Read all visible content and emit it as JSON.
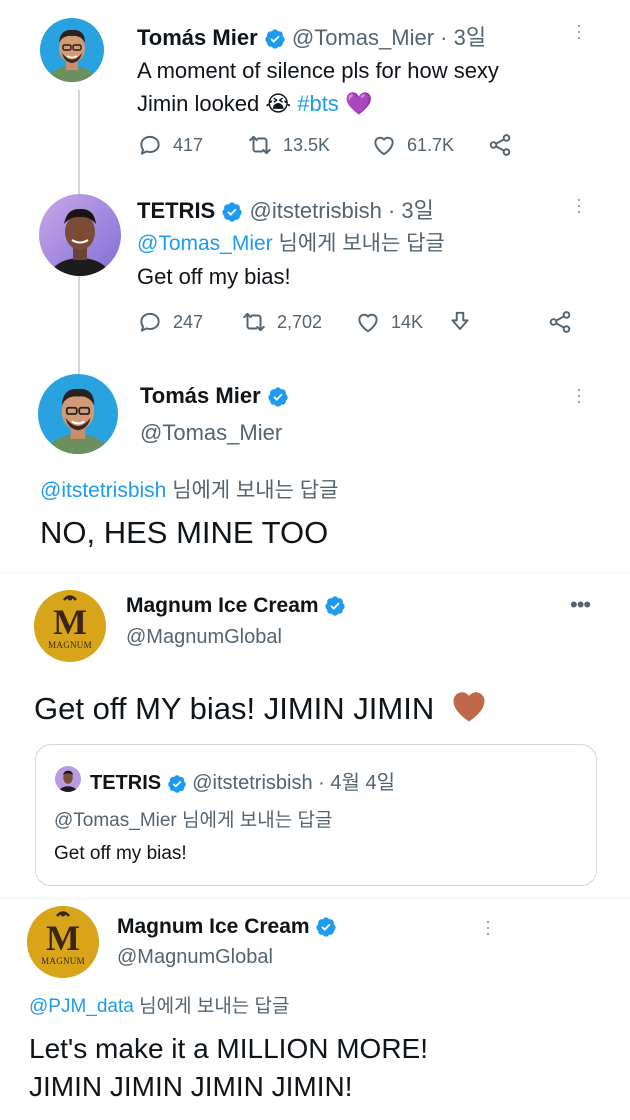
{
  "tweet1": {
    "name": "Tomás Mier",
    "handle": "@Tomas_Mier",
    "time": "· 3일",
    "text_line1": "A moment of silence pls for how sexy",
    "text_line2_pre": "Jimin looked 😭 ",
    "hashtag": "#bts",
    "emoji_after": "💜",
    "replies": "417",
    "retweets": "13.5K",
    "likes": "61.7K"
  },
  "tweet2": {
    "name": "TETRIS",
    "handle": "@itstetrisbish",
    "time": "· 3일",
    "reply_to_handle": "@Tomas_Mier",
    "reply_to_suffix": " 님에게 보내는 답글",
    "text": "Get off my bias!",
    "replies": "247",
    "retweets": "2,702",
    "likes": "14K"
  },
  "tweet3": {
    "name": "Tomás Mier",
    "handle": "@Tomas_Mier",
    "reply_to_handle": "@itstetrisbish",
    "reply_to_suffix": " 님에게 보내는 답글",
    "text": "NO, HES MINE TOO"
  },
  "tweet4": {
    "name": "Magnum Ice Cream",
    "handle": "@MagnumGlobal",
    "text": "Get off MY bias! JIMIN JIMIN",
    "logo_letter": "M",
    "logo_word": "MAGNUM",
    "quote": {
      "name": "TETRIS",
      "handle": "@itstetrisbish",
      "time": "· 4월 4일",
      "reply_to_handle": "@Tomas_Mier",
      "reply_to_suffix": " 님에게 보내는 답글",
      "text": "Get off my bias!"
    }
  },
  "tweet5": {
    "name": "Magnum Ice Cream",
    "handle": "@MagnumGlobal",
    "reply_to_handle": "@PJM_data",
    "reply_to_suffix": " 님에게 보내는 답글",
    "text_line1": "Let's make it a MILLION MORE!",
    "text_line2": "JIMIN JIMIN JIMIN JIMIN!",
    "logo_letter": "M",
    "logo_word": "MAGNUM"
  },
  "colors": {
    "accent": "#1d9bf0",
    "muted": "#536471",
    "heart": "#c0684a",
    "magnum_gold": "#d8a51a"
  }
}
